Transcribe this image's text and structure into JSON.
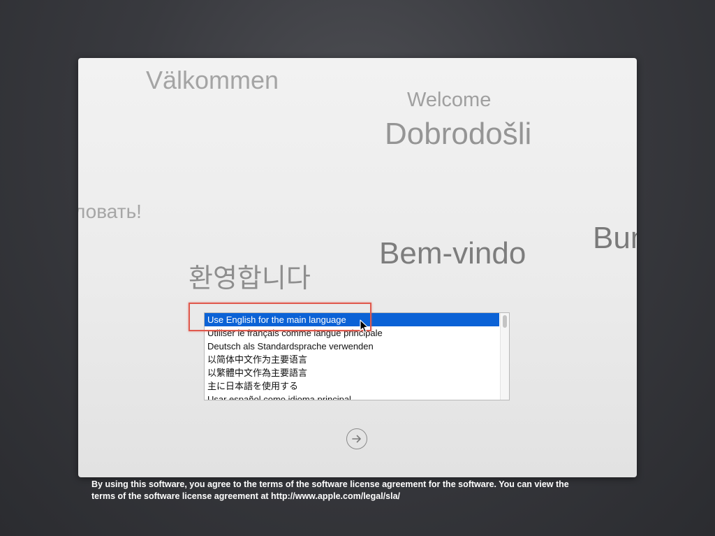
{
  "greetings": {
    "valkommen": "Välkommen",
    "welcome": "Welcome",
    "dobrodosli": "Dobrodošli",
    "russian": "ловать!",
    "bem_vindo": "Bem-vindo",
    "bun": "Bun",
    "korean": "환영합니다"
  },
  "language_list": {
    "selected_index": 0,
    "items": [
      "Use English for the main language",
      "Utiliser le français comme langue principale",
      "Deutsch als Standardsprache verwenden",
      "以简体中文作为主要语言",
      "以繁體中文作為主要語言",
      "主に日本語を使用する",
      "Usar español como idioma principal"
    ]
  },
  "continue_button": {
    "icon": "arrow-right-circle-icon"
  },
  "license": {
    "line1": "By using this software, you agree to the terms of the software license agreement for the software. You can view the",
    "line2": "terms of the software license agreement at http://www.apple.com/legal/sla/"
  },
  "colors": {
    "selection": "#0b62d6",
    "highlight_box": "#e05a4e"
  }
}
